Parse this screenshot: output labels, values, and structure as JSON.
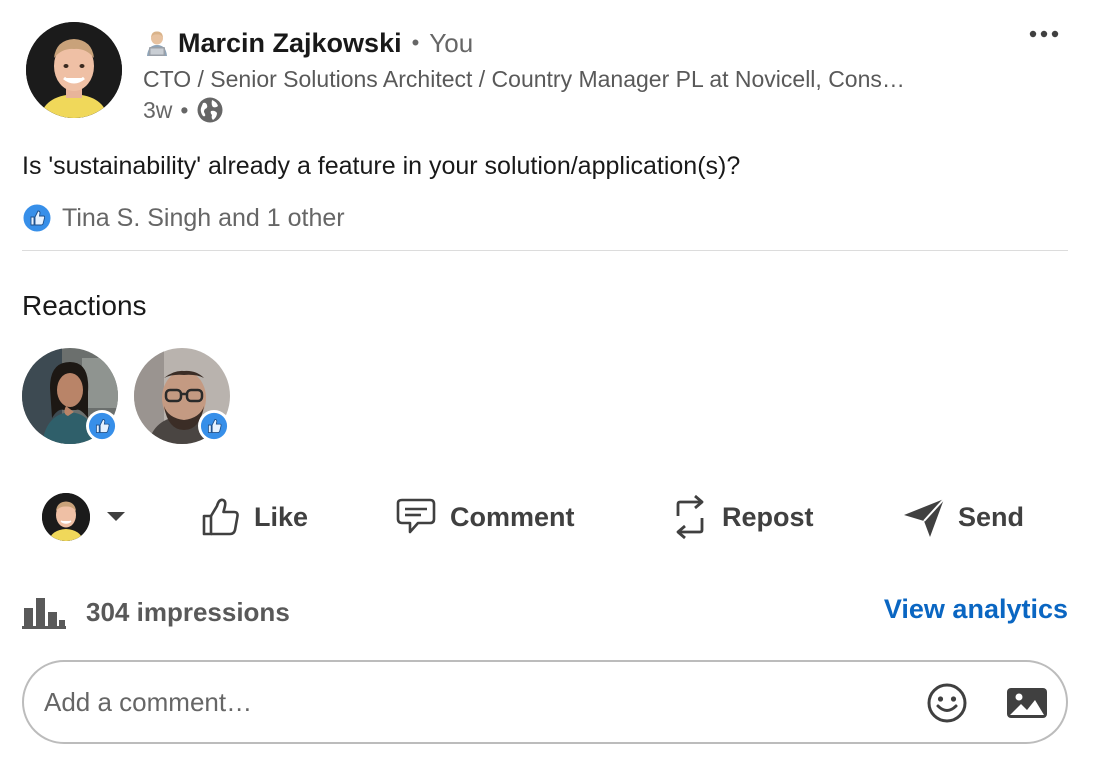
{
  "post": {
    "author": {
      "name": "Marcin Zajkowski",
      "relation": "You",
      "headline": "CTO / Senior Solutions Architect / Country Manager PL at Novicell, Cons…",
      "time_ago": "3w",
      "badge_icon": "technologist-emoji-icon",
      "visibility_icon": "globe-icon"
    },
    "separator": "•",
    "text": "Is 'sustainability' already a feature in your solution/application(s)?",
    "likes_summary": "Tina S. Singh and 1 other"
  },
  "reactions": {
    "title": "Reactions",
    "people": [
      {
        "avatar_icon": "woman-avatar",
        "reaction": "like-icon"
      },
      {
        "avatar_icon": "man-glasses-avatar",
        "reaction": "like-icon"
      }
    ]
  },
  "actions": {
    "like_label": "Like",
    "comment_label": "Comment",
    "repost_label": "Repost",
    "send_label": "Send"
  },
  "analytics": {
    "impressions_label": "304 impressions",
    "view_analytics_label": "View analytics"
  },
  "comment_box": {
    "placeholder": "Add a comment…"
  },
  "colors": {
    "link_blue": "#0a66c2",
    "like_blue": "#378fe9"
  }
}
